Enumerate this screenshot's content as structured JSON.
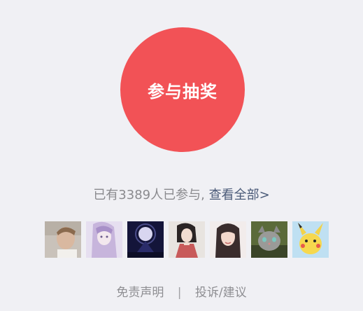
{
  "lottery": {
    "button_label": "参与抽奖",
    "button_color": "#f25256"
  },
  "participants": {
    "text_prefix": "已有3389人已参与,",
    "view_all_label": "查看全部>",
    "count": 3389
  },
  "avatars": [
    {
      "name": "avatar-1"
    },
    {
      "name": "avatar-2"
    },
    {
      "name": "avatar-3"
    },
    {
      "name": "avatar-4"
    },
    {
      "name": "avatar-5"
    },
    {
      "name": "avatar-6"
    },
    {
      "name": "avatar-7"
    }
  ],
  "footer": {
    "disclaimer_label": "免责声明",
    "separator": "|",
    "report_label": "投诉/建议"
  },
  "colors": {
    "background": "#f0f0f4",
    "link": "#4a5a78",
    "muted_text": "#8a8a8e"
  }
}
